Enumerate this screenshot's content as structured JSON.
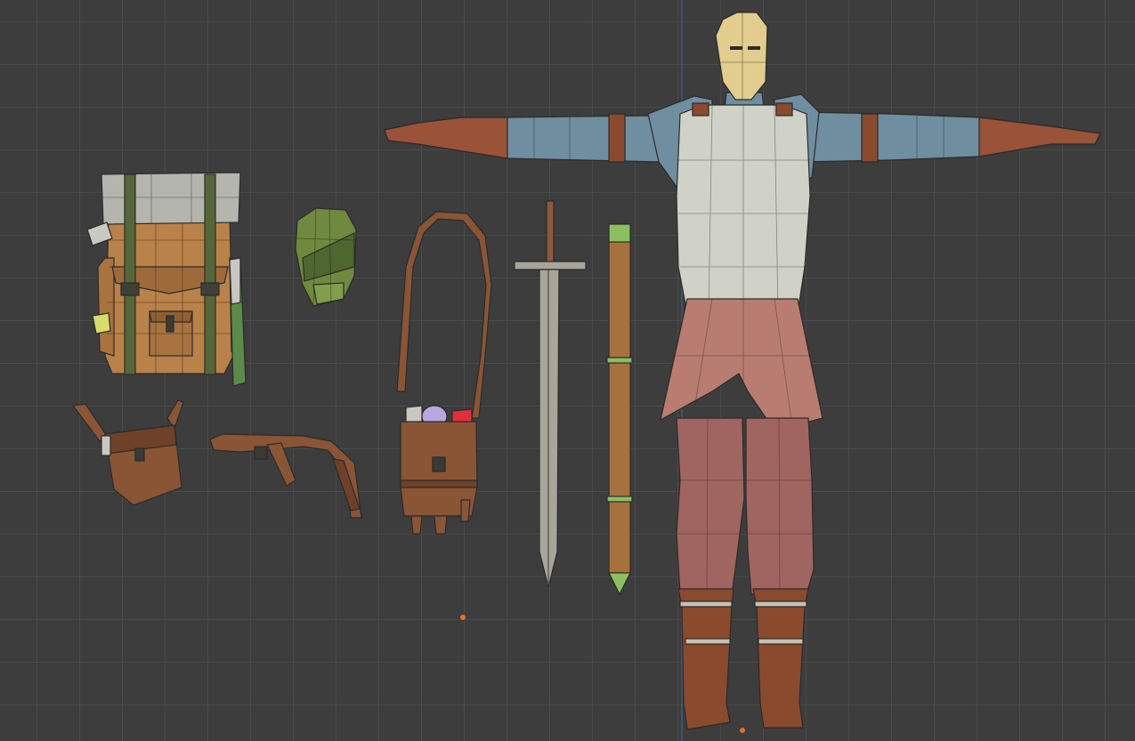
{
  "viewport": {
    "background": "#3d3d3d",
    "grid_color": "#4a4a4a",
    "y_axis_color": "#3f5a8a"
  },
  "objects": [
    {
      "name": "backpack",
      "icon": "backpack-icon",
      "colors": {
        "body": "#b9824a",
        "roll": "#b3b5ae",
        "straps": "#56663a"
      }
    },
    {
      "name": "helmet",
      "icon": "helmet-icon",
      "colors": {
        "body": "#6f8a3e"
      }
    },
    {
      "name": "shoulder-bag",
      "icon": "satchel-icon",
      "colors": {
        "body": "#8a5535",
        "potion_purple": "#b8a8e0",
        "potion_red": "#e0303a"
      }
    },
    {
      "name": "sword",
      "icon": "sword-icon",
      "colors": {
        "blade": "#a8a59a",
        "grip": "#8a5a3a"
      }
    },
    {
      "name": "scabbard",
      "icon": "scabbard-icon",
      "colors": {
        "body": "#a7713e",
        "tip": "#8ac060"
      }
    },
    {
      "name": "pouch",
      "icon": "pouch-icon",
      "colors": {
        "body": "#8a5535"
      }
    },
    {
      "name": "belt",
      "icon": "belt-icon",
      "colors": {
        "body": "#8a5535"
      }
    },
    {
      "name": "character",
      "icon": "character-icon",
      "colors": {
        "head": "#e2cd8f",
        "sleeve": "#6f8ea0",
        "torso": "#d0d2c8",
        "tunic": "#b97c70",
        "pants": "#a06560",
        "boots": "#8a4a2e",
        "glove": "#9a5238"
      }
    }
  ]
}
